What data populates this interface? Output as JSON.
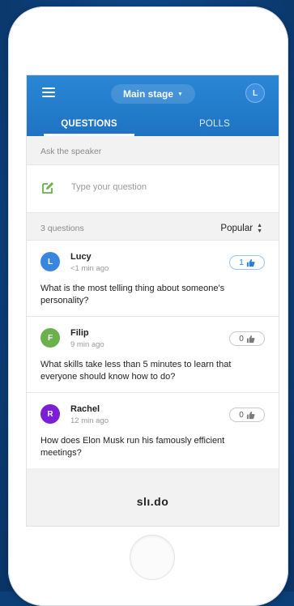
{
  "header": {
    "stage_label": "Main stage",
    "user_initial": "L",
    "tabs": [
      {
        "label": "QUESTIONS"
      },
      {
        "label": "POLLS"
      }
    ]
  },
  "ask": {
    "section_label": "Ask the speaker",
    "placeholder": "Type your question"
  },
  "list": {
    "count_label": "3 questions",
    "sort_label": "Popular"
  },
  "questions": [
    {
      "initial": "L",
      "name": "Lucy",
      "time": "<1 min ago",
      "likes": "1",
      "liked": true,
      "avatar_color": "#3a86de",
      "text": "What is the most telling thing about someone's personality?"
    },
    {
      "initial": "F",
      "name": "Filip",
      "time": "9 min ago",
      "likes": "0",
      "liked": false,
      "avatar_color": "#6ab04c",
      "text": "What skills take less than 5 minutes to learn that everyone should know how to do?"
    },
    {
      "initial": "R",
      "name": "Rachel",
      "time": "12 min ago",
      "likes": "0",
      "liked": false,
      "avatar_color": "#7b1fd6",
      "text": "How does Elon Musk run his famously efficient meetings?"
    }
  ],
  "footer": {
    "logo": "slı.do"
  },
  "colors": {
    "header_blue": "#2a86d6",
    "accent_green": "#6ab04c"
  }
}
